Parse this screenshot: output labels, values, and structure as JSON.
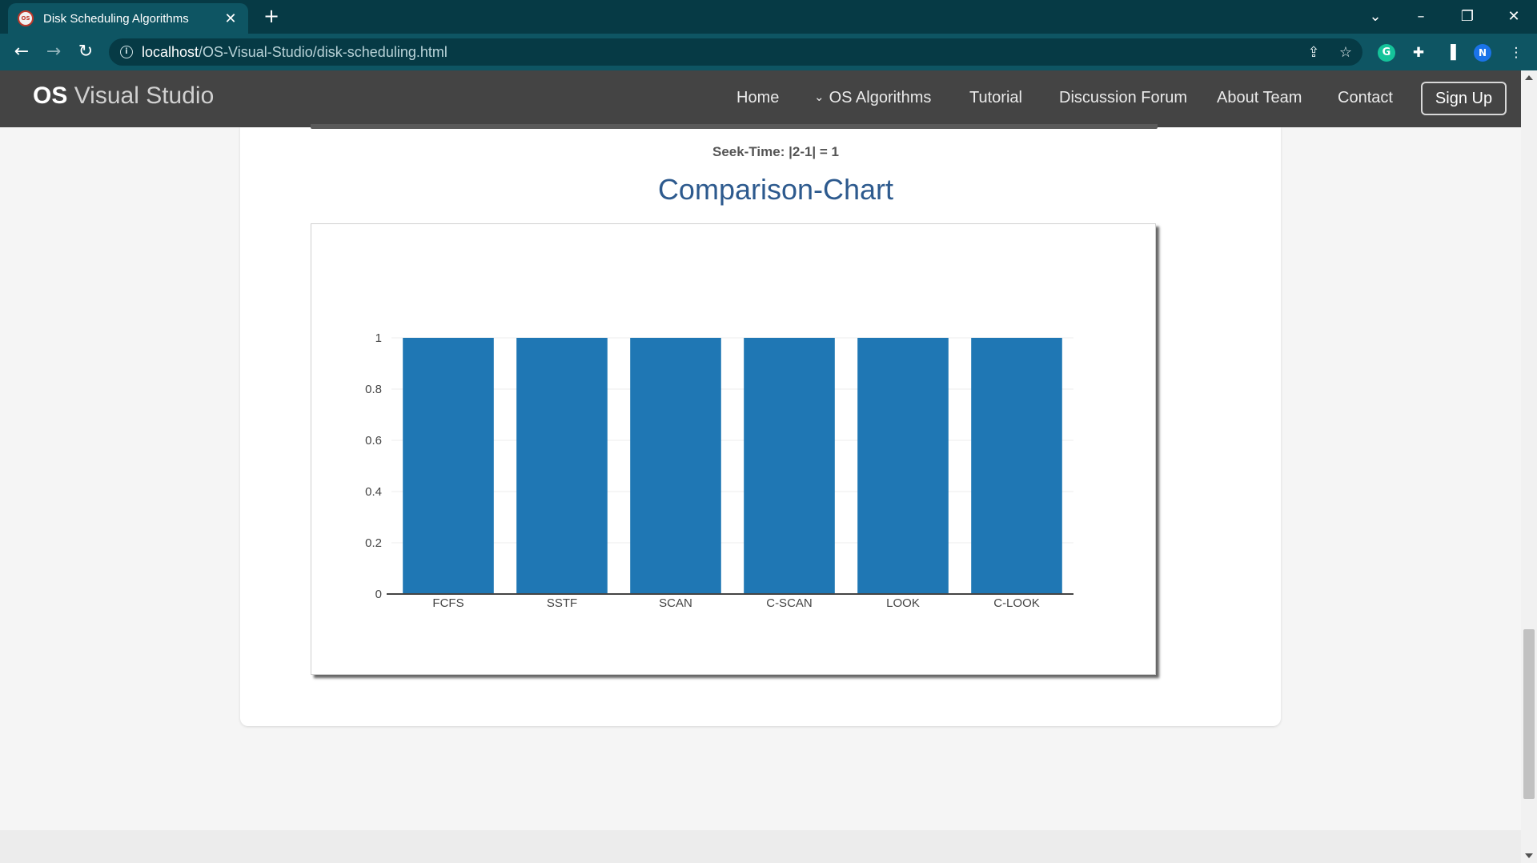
{
  "browser": {
    "tab_title": "Disk Scheduling Algorithms",
    "favicon_text": "OS",
    "url_host": "localhost",
    "url_path": "/OS-Visual-Studio/disk-scheduling.html",
    "profile_initial": "N",
    "grammarly_letter": "G"
  },
  "navbar": {
    "brand_bold": "OS",
    "brand_rest": " Visual Studio",
    "links": {
      "home": "Home",
      "os_algorithms": "OS Algorithms",
      "tutorial": "Tutorial",
      "discussion": "Discussion Forum",
      "about": "About Team",
      "contact": "Contact"
    },
    "signup": "Sign Up"
  },
  "content": {
    "seek_time": "Seek-Time: |2-1| = 1",
    "chart_heading": "Comparison-Chart"
  },
  "chart_data": {
    "type": "bar",
    "categories": [
      "FCFS",
      "SSTF",
      "SCAN",
      "C-SCAN",
      "LOOK",
      "C-LOOK"
    ],
    "values": [
      1,
      1,
      1,
      1,
      1,
      1
    ],
    "ylim": [
      0,
      1
    ],
    "yticks": [
      "0",
      "0.2",
      "0.4",
      "0.6",
      "0.8",
      "1"
    ],
    "bar_color": "#1f77b4",
    "grid": true
  }
}
